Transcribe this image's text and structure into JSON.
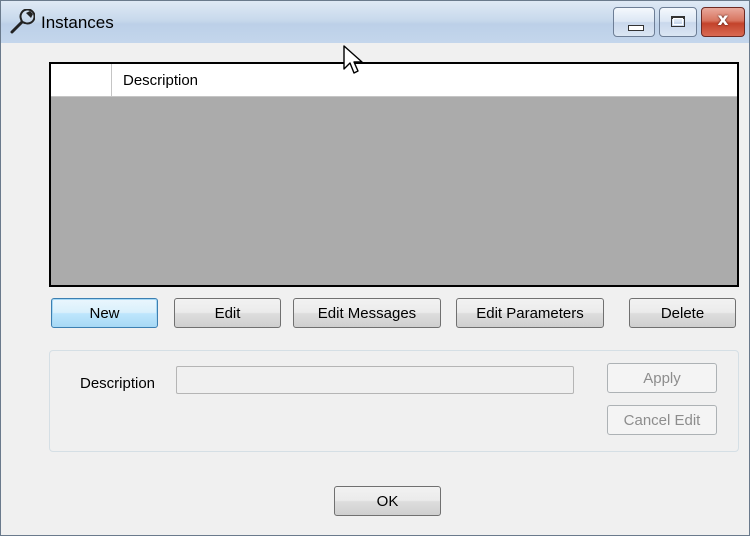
{
  "window": {
    "title": "Instances",
    "icon": "wrench-icon",
    "controls": {
      "minimize_icon": "minimize-icon",
      "maximize_icon": "maximize-icon",
      "close_icon": "close-icon",
      "close_glyph": "x"
    }
  },
  "grid": {
    "columns": [
      "Description"
    ],
    "rows": []
  },
  "toolbar": {
    "new_label": "New",
    "edit_label": "Edit",
    "edit_messages_label": "Edit Messages",
    "edit_parameters_label": "Edit Parameters",
    "delete_label": "Delete"
  },
  "edit_panel": {
    "description_label": "Description",
    "description_value": "",
    "apply_label": "Apply",
    "cancel_edit_label": "Cancel Edit"
  },
  "footer": {
    "ok_label": "OK"
  },
  "colors": {
    "grid_background": "#ababab",
    "window_background": "#f0f0f0",
    "close_button": "#c3432b"
  }
}
